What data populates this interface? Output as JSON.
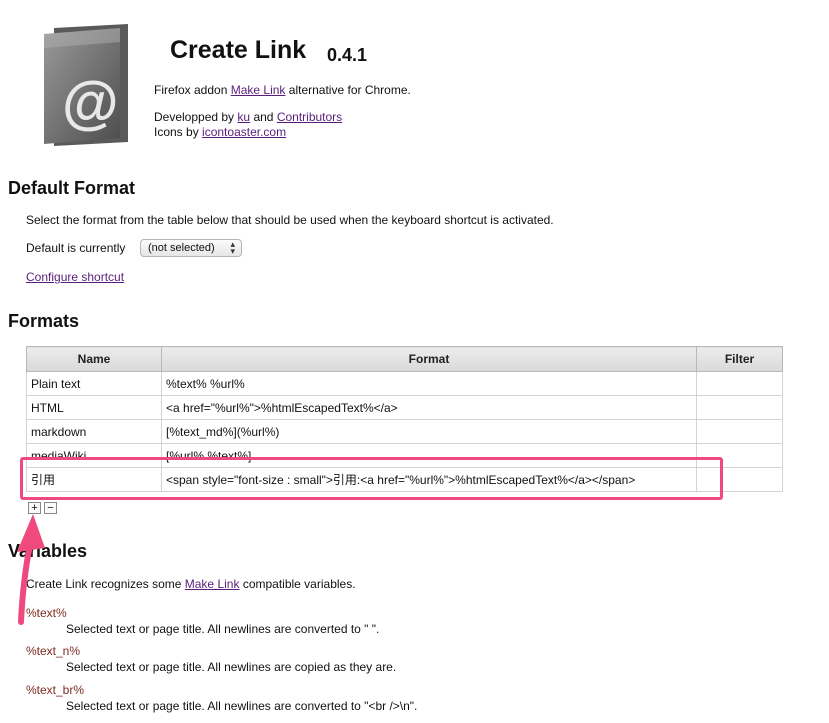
{
  "header": {
    "title": "Create Link",
    "version": "0.4.1",
    "desc_prefix": "Firefox addon",
    "desc_link": "Make Link",
    "desc_suffix": "alternative for Chrome.",
    "dev_prefix": "Developped by",
    "dev_link1": "ku",
    "dev_mid": "and",
    "dev_link2": "Contributors",
    "icons_prefix": "Icons by",
    "icons_link": "icontoaster.com"
  },
  "default_format": {
    "heading": "Default Format",
    "description": "Select the format from the table below that should be used when the keyboard shortcut is activated.",
    "current_label": "Default is currently",
    "select_value": "(not selected)",
    "configure_link": "Configure shortcut"
  },
  "formats": {
    "heading": "Formats",
    "columns": [
      "Name",
      "Format",
      "Filter"
    ],
    "rows": [
      {
        "name": "Plain text",
        "format": "%text% %url%",
        "filter": ""
      },
      {
        "name": "HTML",
        "format": "<a href=\"%url%\">%htmlEscapedText%</a>",
        "filter": ""
      },
      {
        "name": "markdown",
        "format": "[%text_md%](%url%)",
        "filter": ""
      },
      {
        "name": "mediaWiki",
        "format": "[%url% %text%]",
        "filter": ""
      },
      {
        "name": "引用",
        "format": "<span style=\"font-size : small\">引用:<a href=\"%url%\">%htmlEscapedText%</a></span>",
        "filter": ""
      }
    ],
    "add_label": "+",
    "remove_label": "−",
    "highlight_color": "#f0497e"
  },
  "variables": {
    "heading": "Variables",
    "intro_prefix": "Create Link recognizes some",
    "intro_link": "Make Link",
    "intro_suffix": "compatible variables.",
    "items": [
      {
        "name": "%text%",
        "desc": "Selected text or page title. All newlines are converted to \" \"."
      },
      {
        "name": "%text_n%",
        "desc": "Selected text or page title. All newlines are copied as they are."
      },
      {
        "name": "%text_br%",
        "desc": "Selected text or page title. All newlines are converted to \"<br />\\n\"."
      }
    ]
  },
  "colors": {
    "link": "#5a1e7a",
    "annotation": "#f0497e"
  },
  "icons": {
    "logo": "at-sign-folder-icon",
    "arrow": "pink-arrow-annotation"
  }
}
